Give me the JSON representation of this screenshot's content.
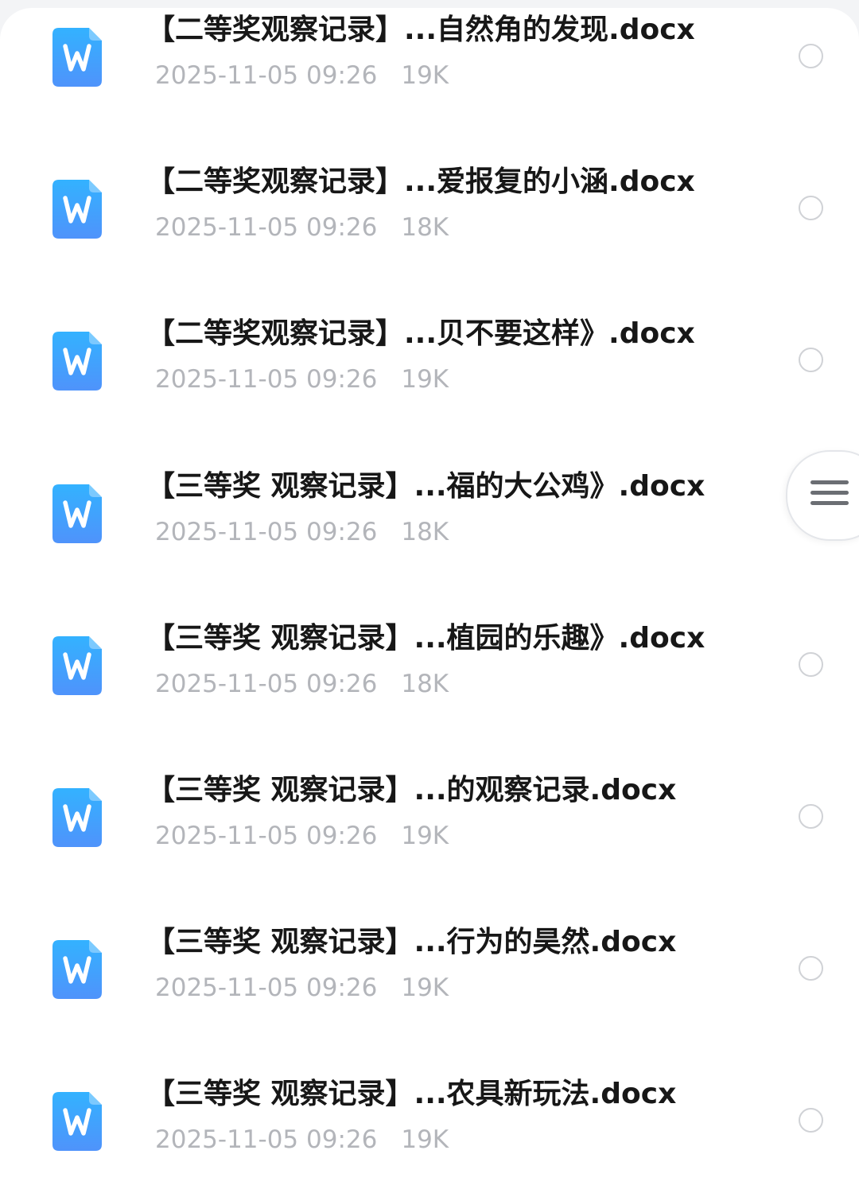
{
  "file_list": {
    "items": [
      {
        "name": "【二等奖观察记录】...自然角的发现.docx",
        "date": "2025-11-05 09:26",
        "size": "19K",
        "icon": "word-doc-icon",
        "selected": false
      },
      {
        "name": "【二等奖观察记录】...爱报复的小涵.docx",
        "date": "2025-11-05 09:26",
        "size": "18K",
        "icon": "word-doc-icon",
        "selected": false
      },
      {
        "name": "【二等奖观察记录】...贝不要这样》.docx",
        "date": "2025-11-05 09:26",
        "size": "19K",
        "icon": "word-doc-icon",
        "selected": false
      },
      {
        "name": "【三等奖 观察记录】...福的大公鸡》.docx",
        "date": "2025-11-05 09:26",
        "size": "18K",
        "icon": "word-doc-icon",
        "selected": false
      },
      {
        "name": "【三等奖 观察记录】...植园的乐趣》.docx",
        "date": "2025-11-05 09:26",
        "size": "18K",
        "icon": "word-doc-icon",
        "selected": false
      },
      {
        "name": "【三等奖 观察记录】...的观察记录.docx",
        "date": "2025-11-05 09:26",
        "size": "19K",
        "icon": "word-doc-icon",
        "selected": false
      },
      {
        "name": "【三等奖 观察记录】...行为的昊然.docx",
        "date": "2025-11-05 09:26",
        "size": "19K",
        "icon": "word-doc-icon",
        "selected": false
      },
      {
        "name": "【三等奖 观察记录】...农具新玩法.docx",
        "date": "2025-11-05 09:26",
        "size": "19K",
        "icon": "word-doc-icon",
        "selected": false
      }
    ]
  },
  "side_handle": {
    "icon": "menu-icon"
  },
  "colors": {
    "icon_gradient_top": "#33b2ff",
    "icon_gradient_bottom": "#4f93fb",
    "title_text": "#171717",
    "meta_text": "#b3b5ba",
    "circle_border": "#d0d2d6"
  }
}
